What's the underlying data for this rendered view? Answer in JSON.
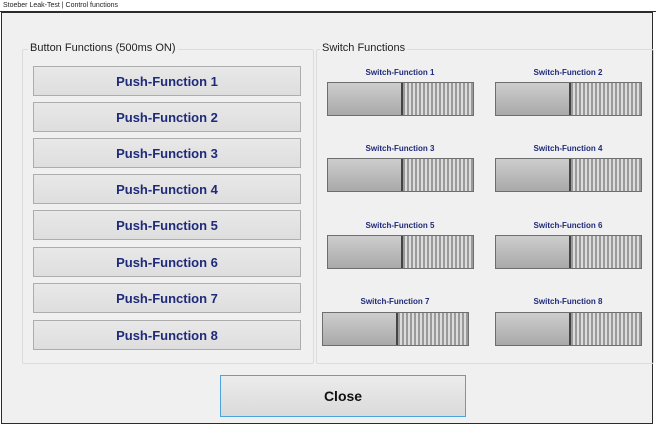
{
  "window": {
    "title": "Stoeber Leak-Test | Control functions"
  },
  "button_functions": {
    "title": "Button Functions (500ms ON)",
    "buttons": [
      "Push-Function 1",
      "Push-Function 2",
      "Push-Function 3",
      "Push-Function 4",
      "Push-Function 5",
      "Push-Function 6",
      "Push-Function 7",
      "Push-Function 8"
    ]
  },
  "switch_functions": {
    "title": "Switch Functions",
    "switches": [
      {
        "label": "Switch-Function 1",
        "state": "off"
      },
      {
        "label": "Switch-Function 2",
        "state": "off"
      },
      {
        "label": "Switch-Function 3",
        "state": "off"
      },
      {
        "label": "Switch-Function 4",
        "state": "off"
      },
      {
        "label": "Switch-Function 5",
        "state": "off"
      },
      {
        "label": "Switch-Function 6",
        "state": "off"
      },
      {
        "label": "Switch-Function 7",
        "state": "off"
      },
      {
        "label": "Switch-Function 8",
        "state": "off"
      }
    ]
  },
  "footer": {
    "close_label": "Close"
  },
  "colors": {
    "label_blue": "#1f2a7a",
    "close_border": "#4da3de"
  }
}
